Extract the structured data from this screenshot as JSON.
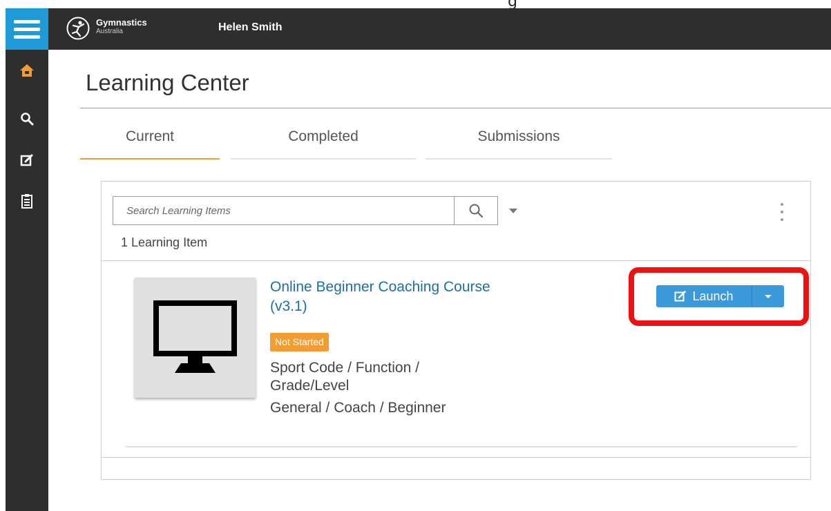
{
  "top_cut_text": "g",
  "header": {
    "brand_name": "Gymnastics",
    "brand_sub": "Australia",
    "user_name": "Helen Smith",
    "accent": "#1f9ad6"
  },
  "sidebar": {
    "items": [
      {
        "icon": "home-icon",
        "color": "#f39c32"
      },
      {
        "icon": "search-icon",
        "color": "#ffffff"
      },
      {
        "icon": "edit-icon",
        "color": "#ffffff"
      },
      {
        "icon": "clipboard-icon",
        "color": "#ffffff"
      }
    ]
  },
  "page": {
    "title": "Learning Center"
  },
  "tabs": [
    {
      "label": "Current",
      "active": true
    },
    {
      "label": "Completed",
      "active": false
    },
    {
      "label": "Submissions",
      "active": false
    }
  ],
  "search": {
    "placeholder": "Search Learning Items",
    "value": ""
  },
  "results": {
    "count_text": "1 Learning Item"
  },
  "course": {
    "title": "Online Beginner Coaching Course (v3.1)",
    "status": "Not Started",
    "status_color": "#f39c32",
    "meta_header": "Sport Code / Function / Grade/Level",
    "meta_value": "General / Coach / Beginner",
    "launch_label": "Launch"
  }
}
